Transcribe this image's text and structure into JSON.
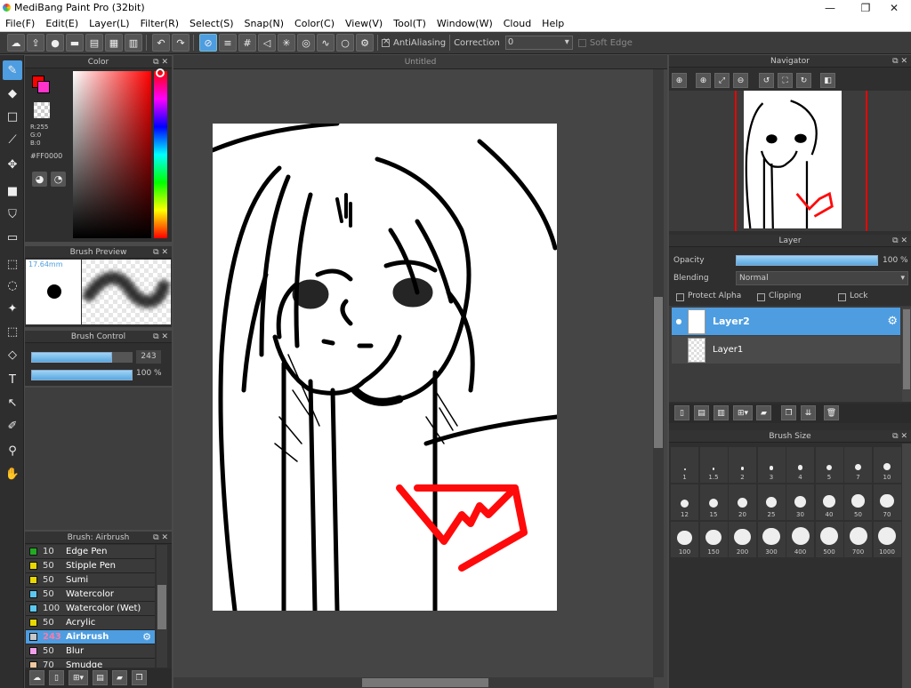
{
  "window": {
    "title": "MediBang Paint Pro (32bit)",
    "min": "—",
    "max": "❐",
    "close": "✕"
  },
  "menu": [
    "File(F)",
    "Edit(E)",
    "Layer(L)",
    "Filter(R)",
    "Select(S)",
    "Snap(N)",
    "Color(C)",
    "View(V)",
    "Tool(T)",
    "Window(W)",
    "Cloud",
    "Help"
  ],
  "toolbar": {
    "antialias_label": "AntiAliasing",
    "correction_label": "Correction",
    "correction_value": "0",
    "soft_edge_label": "Soft Edge"
  },
  "color": {
    "title": "Color",
    "r": "R:255",
    "g": "G:0",
    "b": "B:0",
    "hex": "#FF0000",
    "primary": "#ff0000",
    "secondary": "#ff33cc"
  },
  "brush_preview": {
    "title": "Brush Preview",
    "size": "17.64mm"
  },
  "brush_control": {
    "title": "Brush Control",
    "size_value": "243",
    "opacity_value": "100 %",
    "size_fraction": 0.8,
    "opacity_fraction": 1.0
  },
  "canvas": {
    "tab": "Untitled"
  },
  "brush_list": {
    "title": "Brush: Airbrush",
    "items": [
      {
        "size": "10",
        "name": "Edge Pen",
        "color": "#22aa22"
      },
      {
        "size": "50",
        "name": "Stipple Pen",
        "color": "#e8d800"
      },
      {
        "size": "50",
        "name": "Sumi",
        "color": "#e8d800"
      },
      {
        "size": "50",
        "name": "Watercolor",
        "color": "#5bc8f0"
      },
      {
        "size": "100",
        "name": "Watercolor (Wet)",
        "color": "#5bc8f0"
      },
      {
        "size": "50",
        "name": "Acrylic",
        "color": "#e8d800"
      },
      {
        "size": "243",
        "name": "Airbrush",
        "color": "#c8c8c8"
      },
      {
        "size": "50",
        "name": "Blur",
        "color": "#f0a0e8"
      },
      {
        "size": "70",
        "name": "Smudge",
        "color": "#f0c8a0"
      }
    ]
  },
  "navigator": {
    "title": "Navigator"
  },
  "layer": {
    "title": "Layer",
    "opacity_label": "Opacity",
    "opacity_value": "100 %",
    "opacity_fraction": 1.0,
    "blending_label": "Blending",
    "blending_value": "Normal",
    "protect_alpha": "Protect Alpha",
    "clipping": "Clipping",
    "lock": "Lock",
    "layers": [
      "Layer2",
      "Layer1"
    ]
  },
  "brush_size": {
    "title": "Brush Size",
    "sizes": [
      "1",
      "1.5",
      "2",
      "3",
      "4",
      "5",
      "7",
      "10",
      "12",
      "15",
      "20",
      "25",
      "30",
      "40",
      "50",
      "70",
      "100",
      "150",
      "200",
      "300",
      "400",
      "500",
      "700",
      "1000"
    ]
  },
  "icons": {
    "float": "float-panel-icon",
    "close": "close-icon"
  }
}
